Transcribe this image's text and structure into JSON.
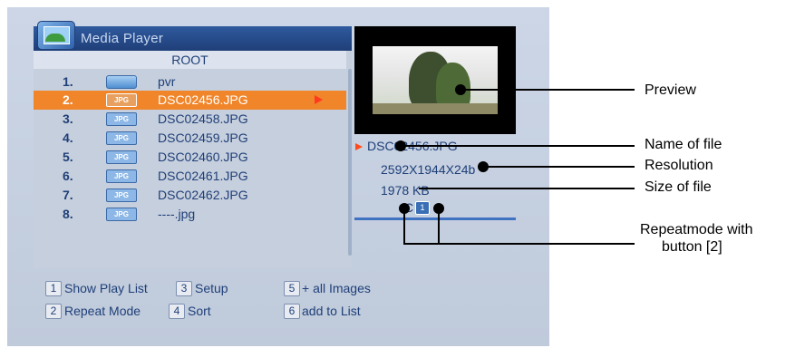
{
  "player": {
    "title": "Media Player",
    "path": "ROOT",
    "files": [
      {
        "num": "1.",
        "type": "folder",
        "name": "pvr"
      },
      {
        "num": "2.",
        "type": "JPG",
        "name": "DSC02456.JPG",
        "selected": true
      },
      {
        "num": "3.",
        "type": "JPG",
        "name": "DSC02458.JPG"
      },
      {
        "num": "4.",
        "type": "JPG",
        "name": "DSC02459.JPG"
      },
      {
        "num": "5.",
        "type": "JPG",
        "name": "DSC02460.JPG"
      },
      {
        "num": "6.",
        "type": "JPG",
        "name": "DSC02461.JPG"
      },
      {
        "num": "7.",
        "type": "JPG",
        "name": "DSC02462.JPG"
      },
      {
        "num": "8.",
        "type": "JPG",
        "name": "----.jpg"
      }
    ]
  },
  "info": {
    "filename": "DSC02456.JPG",
    "resolution": "2592X1944X24b",
    "size": "1978 KB",
    "repeat_prefix": "C",
    "repeat_icon": "1"
  },
  "buttons": [
    {
      "key": "1",
      "label": "Show Play List"
    },
    {
      "key": "3",
      "label": "Setup"
    },
    {
      "key": "5",
      "label": "+ all Images"
    },
    {
      "key": "2",
      "label": "Repeat Mode"
    },
    {
      "key": "4",
      "label": "Sort"
    },
    {
      "key": "6",
      "label": "add to List"
    }
  ],
  "callouts": {
    "preview": "Preview",
    "name_of_file": "Name of file",
    "resolution": "Resolution",
    "size_of_file": "Size of file",
    "repeatmode_line1": "Repeatmode with",
    "repeatmode_line2": "button [2]"
  },
  "colors": {
    "selection": "#f0852a",
    "title_bar": "#1f3f78",
    "text": "#1f3f78"
  }
}
